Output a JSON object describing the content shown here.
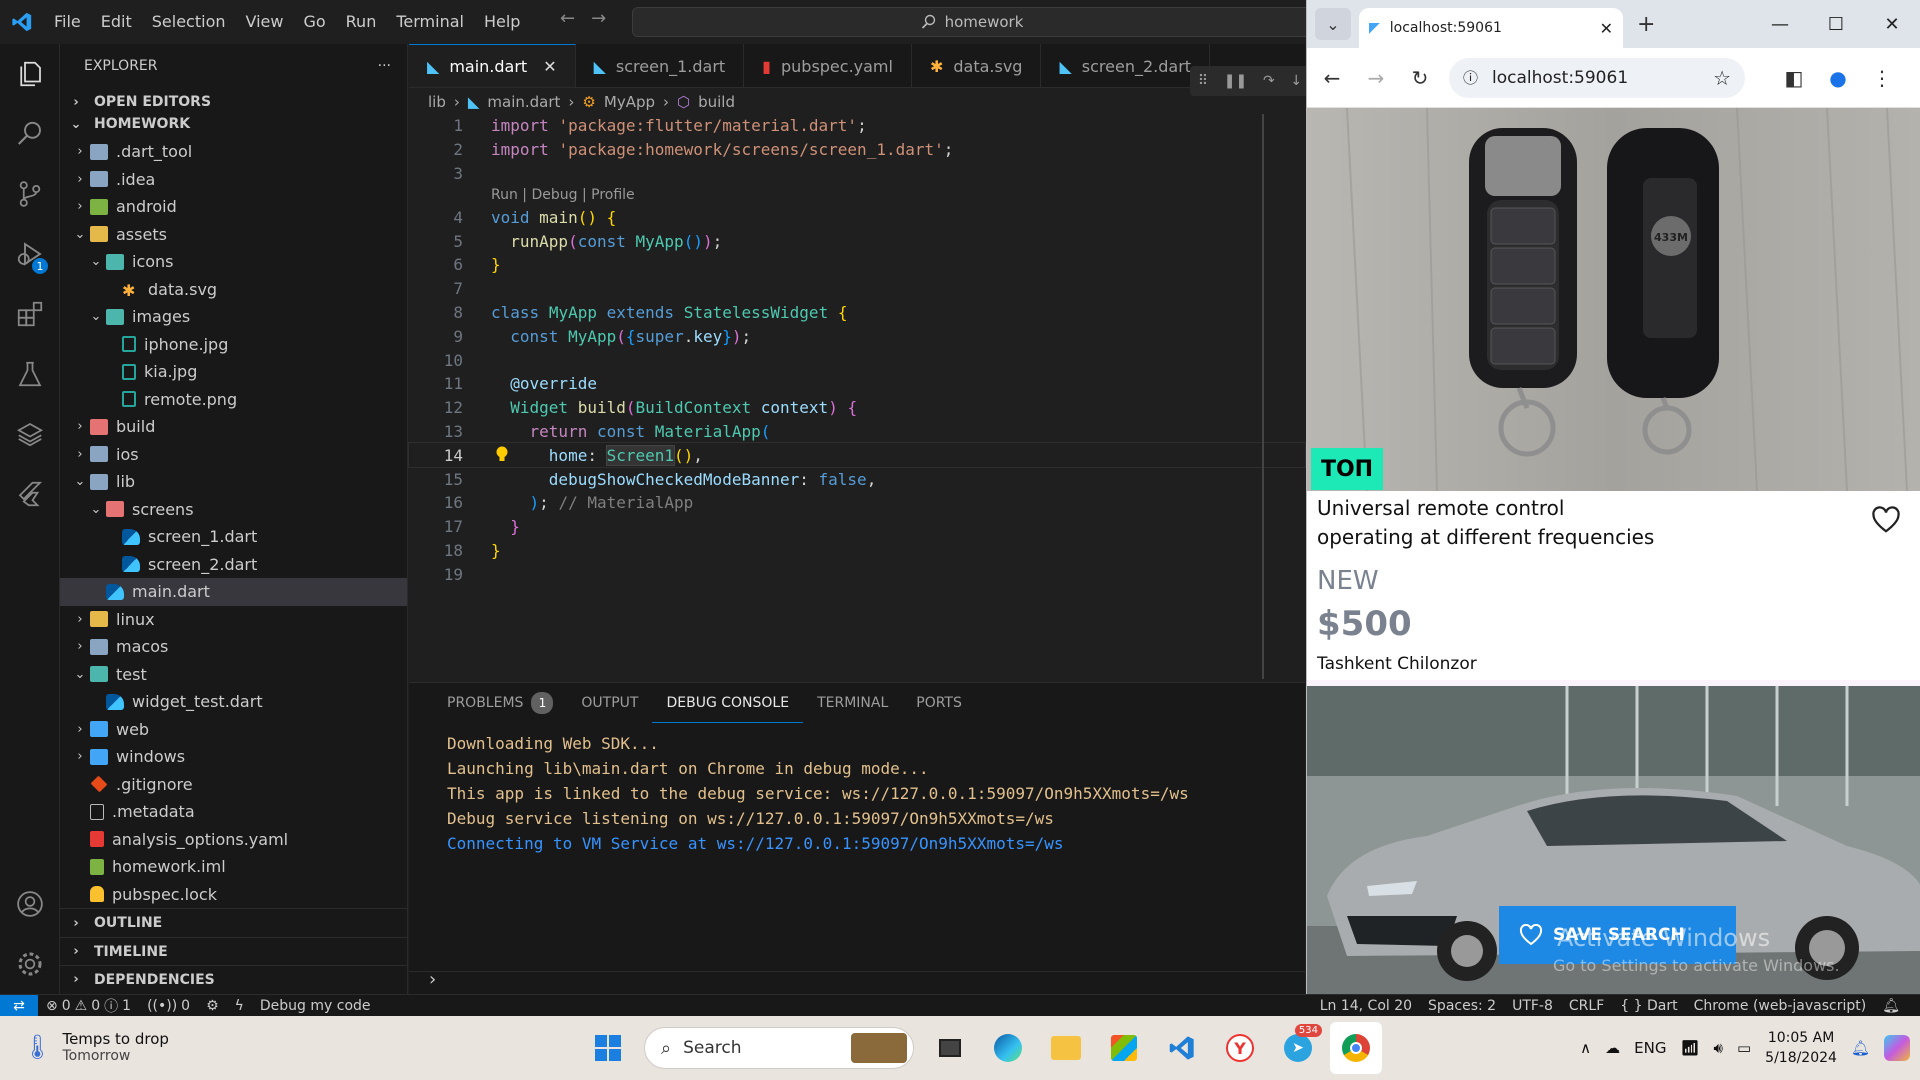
{
  "titlebar": {
    "menu": [
      "File",
      "Edit",
      "Selection",
      "View",
      "Go",
      "Run",
      "Terminal",
      "Help"
    ],
    "command_center": "homework"
  },
  "activity": {
    "run_badge": "1"
  },
  "explorer": {
    "title": "EXPLORER",
    "more": "···",
    "open_editors": "OPEN EDITORS",
    "root": "HOMEWORK",
    "tree": [
      {
        "label": ".dart_tool",
        "depth": 0,
        "kind": "folder",
        "twisty": "›"
      },
      {
        "label": ".idea",
        "depth": 0,
        "kind": "folder",
        "twisty": "›"
      },
      {
        "label": "android",
        "depth": 0,
        "kind": "folder-green",
        "twisty": "›"
      },
      {
        "label": "assets",
        "depth": 0,
        "kind": "folder-yellow",
        "twisty": "⌄"
      },
      {
        "label": "icons",
        "depth": 1,
        "kind": "folder-teal",
        "twisty": "⌄"
      },
      {
        "label": "data.svg",
        "depth": 2,
        "kind": "svg",
        "twisty": ""
      },
      {
        "label": "images",
        "depth": 1,
        "kind": "folder-teal",
        "twisty": "⌄"
      },
      {
        "label": "iphone.jpg",
        "depth": 2,
        "kind": "img",
        "twisty": ""
      },
      {
        "label": "kia.jpg",
        "depth": 2,
        "kind": "img",
        "twisty": ""
      },
      {
        "label": "remote.png",
        "depth": 2,
        "kind": "img",
        "twisty": ""
      },
      {
        "label": "build",
        "depth": 0,
        "kind": "folder-red",
        "twisty": "›"
      },
      {
        "label": "ios",
        "depth": 0,
        "kind": "folder",
        "twisty": "›"
      },
      {
        "label": "lib",
        "depth": 0,
        "kind": "folder",
        "twisty": "⌄"
      },
      {
        "label": "screens",
        "depth": 1,
        "kind": "folder-red",
        "twisty": "⌄"
      },
      {
        "label": "screen_1.dart",
        "depth": 2,
        "kind": "dart",
        "twisty": ""
      },
      {
        "label": "screen_2.dart",
        "depth": 2,
        "kind": "dart",
        "twisty": ""
      },
      {
        "label": "main.dart",
        "depth": 1,
        "kind": "dart",
        "twisty": "",
        "selected": true
      },
      {
        "label": "linux",
        "depth": 0,
        "kind": "folder-yellow",
        "twisty": "›"
      },
      {
        "label": "macos",
        "depth": 0,
        "kind": "folder",
        "twisty": "›"
      },
      {
        "label": "test",
        "depth": 0,
        "kind": "folder-teal",
        "twisty": "⌄"
      },
      {
        "label": "widget_test.dart",
        "depth": 1,
        "kind": "dart",
        "twisty": ""
      },
      {
        "label": "web",
        "depth": 0,
        "kind": "folder-blue",
        "twisty": "›"
      },
      {
        "label": "windows",
        "depth": 0,
        "kind": "folder-blue",
        "twisty": "›"
      },
      {
        "label": ".gitignore",
        "depth": 0,
        "kind": "git",
        "twisty": ""
      },
      {
        "label": ".metadata",
        "depth": 0,
        "kind": "file",
        "twisty": ""
      },
      {
        "label": "analysis_options.yaml",
        "depth": 0,
        "kind": "yaml",
        "twisty": ""
      },
      {
        "label": "homework.iml",
        "depth": 0,
        "kind": "iml",
        "twisty": ""
      },
      {
        "label": "pubspec.lock",
        "depth": 0,
        "kind": "lock",
        "twisty": ""
      }
    ],
    "outline": "OUTLINE",
    "timeline": "TIMELINE",
    "dependencies": "DEPENDENCIES"
  },
  "tabs": [
    {
      "label": "main.dart",
      "kind": "dart",
      "active": true
    },
    {
      "label": "screen_1.dart",
      "kind": "dart"
    },
    {
      "label": "pubspec.yaml",
      "kind": "yaml"
    },
    {
      "label": "data.svg",
      "kind": "svg"
    },
    {
      "label": "screen_2.dart",
      "kind": "dart"
    }
  ],
  "breadcrumb": [
    "lib",
    "main.dart",
    "MyApp",
    "build"
  ],
  "code": {
    "codelens": "Run | Debug | Profile",
    "current_line": 14,
    "lines": [
      {
        "n": 1,
        "html": "<span class='kw2'>import</span> <span class='str'>'package:flutter/material.dart'</span><span class='plain'>;</span>"
      },
      {
        "n": 2,
        "html": "<span class='kw2'>import</span> <span class='str'>'package:homework/screens/screen_1.dart'</span><span class='plain'>;</span>"
      },
      {
        "n": 3,
        "html": ""
      },
      {
        "n": 4,
        "html": "<span class='kw'>void</span> <span class='fn'>main</span><span class='br1'>()</span> <span class='br1'>{</span>"
      },
      {
        "n": 5,
        "html": "  <span class='fn'>runApp</span><span class='br2'>(</span><span class='kw'>const</span> <span class='cls'>MyApp</span><span class='br3'>()</span><span class='br2'>)</span><span class='plain'>;</span>"
      },
      {
        "n": 6,
        "html": "<span class='br1'>}</span>"
      },
      {
        "n": 7,
        "html": ""
      },
      {
        "n": 8,
        "html": "<span class='kw'>class</span> <span class='cls'>MyApp</span> <span class='kw'>extends</span> <span class='cls'>StatelessWidget</span> <span class='br1'>{</span>"
      },
      {
        "n": 9,
        "html": "  <span class='kw'>const</span> <span class='cls'>MyApp</span><span class='br2'>(</span><span class='br3'>{</span><span class='kw'>super</span><span class='plain'>.</span><span class='par'>key</span><span class='br3'>}</span><span class='br2'>)</span><span class='plain'>;</span>"
      },
      {
        "n": 10,
        "html": ""
      },
      {
        "n": 11,
        "html": "  <span class='par'>@override</span>"
      },
      {
        "n": 12,
        "html": "  <span class='cls'>Widget</span> <span class='fn'>build</span><span class='br2'>(</span><span class='cls'>BuildContext</span> <span class='par'>context</span><span class='br2'>)</span> <span class='br2'>{</span>"
      },
      {
        "n": 13,
        "html": "    <span class='kw2'>return</span> <span class='kw'>const</span> <span class='cls'>MaterialApp</span><span class='br3'>(</span>"
      },
      {
        "n": 14,
        "html": "      <span class='par'>home</span><span class='plain'>: </span><span class='cls hl'>Screen1</span><span class='br1'>()</span><span class='plain'>,</span>"
      },
      {
        "n": 15,
        "html": "      <span class='par'>debugShowCheckedModeBanner</span><span class='plain'>: </span><span class='kw'>false</span><span class='plain'>,</span>"
      },
      {
        "n": 16,
        "html": "    <span class='br3'>)</span><span class='plain'>; </span><span class='grey'>// MaterialApp</span>"
      },
      {
        "n": 17,
        "html": "  <span class='br2'>}</span>"
      },
      {
        "n": 18,
        "html": "<span class='br1'>}</span>"
      },
      {
        "n": 19,
        "html": ""
      }
    ]
  },
  "panel": {
    "tabs": [
      "PROBLEMS",
      "OUTPUT",
      "DEBUG CONSOLE",
      "TERMINAL",
      "PORTS"
    ],
    "problems_count": "1",
    "active_tab": "DEBUG CONSOLE",
    "console": [
      {
        "text": "Downloading Web SDK...",
        "color": "yellow"
      },
      {
        "text": "Launching lib\\main.dart on Chrome in debug mode...",
        "color": "yellow"
      },
      {
        "text": "This app is linked to the debug service: ws://127.0.0.1:59097/On9h5XXmots=/ws",
        "color": "yellow"
      },
      {
        "text": "Debug service listening on ws://127.0.0.1:59097/On9h5XXmots=/ws",
        "color": "yellow"
      },
      {
        "text": "Connecting to VM Service at ws://127.0.0.1:59097/On9h5XXmots=/ws",
        "color": "blue"
      }
    ],
    "prompt": "›"
  },
  "statusbar": {
    "errors": "0",
    "warnings": "0",
    "info": "1",
    "ports": "0",
    "debug_label": "Debug my code",
    "position": "Ln 14, Col 20",
    "spaces": "Spaces: 2",
    "encoding": "UTF-8",
    "eol": "CRLF",
    "language": "{ } Dart",
    "device": "Chrome (web-javascript)"
  },
  "browser": {
    "tab_title": "localhost:59061",
    "url": "localhost:59061",
    "card1": {
      "badge": "ТОП",
      "title_line1": "Universal remote control",
      "title_line2": "operating at different frequencies",
      "condition": "NEW",
      "price": "$500",
      "location": "Tashkent Chilonzor",
      "chip_text": "433M"
    },
    "save_search": "SAVE SEARCH",
    "watermark_title": "Activate Windows",
    "watermark_sub": "Go to Settings to activate Windows."
  },
  "taskbar": {
    "weather_title": "Temps to drop",
    "weather_sub": "Tomorrow",
    "search_label": "Search",
    "telegram_badge": "534",
    "lang": "ENG",
    "time": "10:05 AM",
    "date": "5/18/2024"
  }
}
